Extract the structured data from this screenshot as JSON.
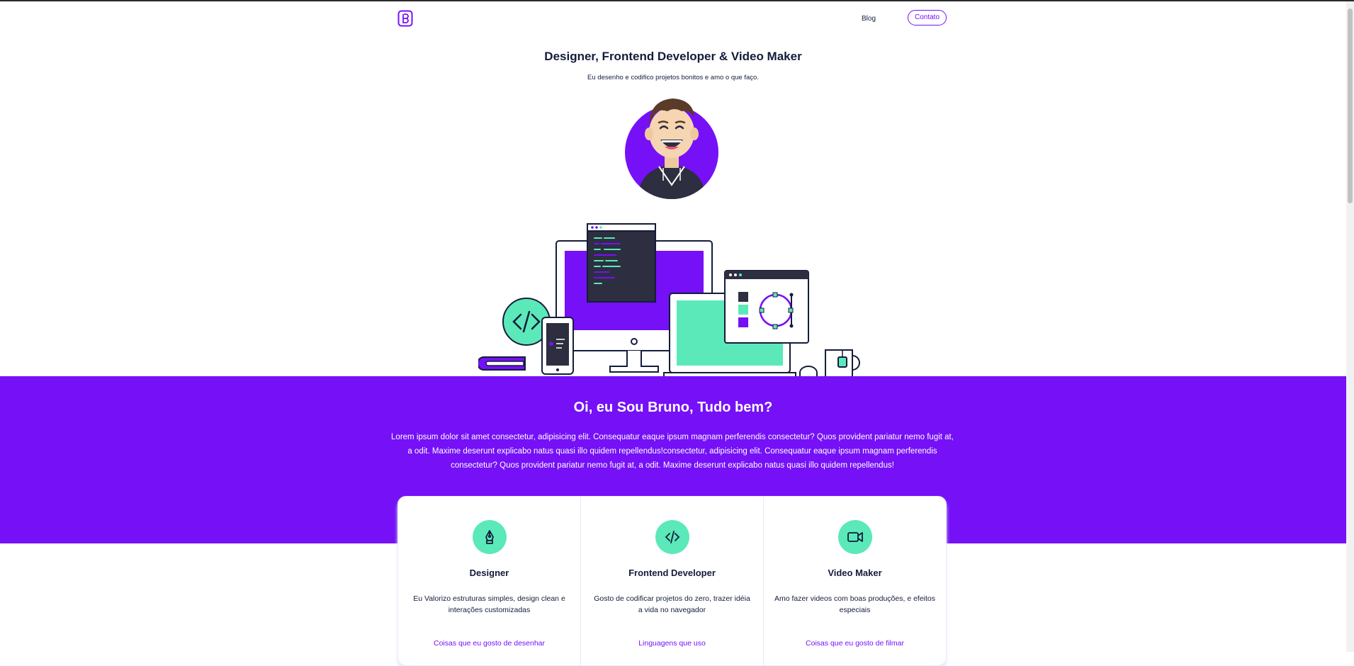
{
  "nav": {
    "blog": "Blog",
    "contact": "Contato"
  },
  "hero": {
    "title": "Designer, Frontend Developer & Video Maker",
    "subtitle": "Eu desenho e codifico projetos bonitos e amo o que faço."
  },
  "about": {
    "title": "Oi, eu Sou Bruno, Tudo bem?",
    "text": "Lorem ipsum dolor sit amet consectetur, adipisicing elit. Consequatur eaque ipsum magnam perferendis consectetur? Quos provident pariatur nemo fugit at, a odit. Maxime deserunt explicabo natus quasi illo quidem repellendus!consectetur, adipisicing elit. Consequatur eaque ipsum magnam perferendis consectetur? Quos provident pariatur nemo fugit at, a odit. Maxime deserunt explicabo natus quasi illo quidem repellendus!"
  },
  "skills": [
    {
      "icon": "pen-nib-icon",
      "title": "Designer",
      "description": "Eu Valorizo estruturas simples, design clean e interações customizadas",
      "link": "Coisas que eu gosto de desenhar"
    },
    {
      "icon": "code-icon",
      "title": "Frontend Developer",
      "description": "Gosto de codificar projetos do zero, trazer idéia a vida no navegador",
      "link": "Linguagens que uso"
    },
    {
      "icon": "video-camera-icon",
      "title": "Video Maker",
      "description": "Amo fazer videos com boas produções, e efeitos especiais",
      "link": "Coisas que eu gosto de filmar"
    }
  ],
  "colors": {
    "primary": "#7510f7",
    "accent": "#5be9b9",
    "dark": "#141c3a"
  }
}
